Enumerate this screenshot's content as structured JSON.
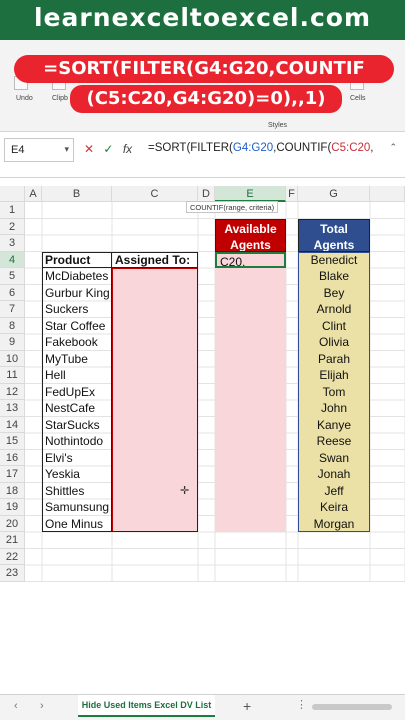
{
  "banner": {
    "text": "learnexceltoexcel.com"
  },
  "ribbon": {
    "undo_label": "Undo",
    "clipboard_label": "Clipb",
    "cells_label": "Cells",
    "styles_label": "Styles"
  },
  "overlay": {
    "line1": "=SORT(FILTER(G4:G20,COUNTIF",
    "line2": "(C5:C20,G4:G20)=0),,1)"
  },
  "formula_bar": {
    "name_box": "E4",
    "formula_prefix": "=SORT(FILTER(",
    "formula_ref1": "G4:G20",
    "formula_mid": ",COUNTIF(",
    "formula_ref2": "C5:C20",
    "formula_suffix": ","
  },
  "tooltip": "COUNTIF(range, criteria)",
  "columns": [
    "A",
    "B",
    "C",
    "D",
    "E",
    "F",
    "G"
  ],
  "rows": [
    "1",
    "2",
    "3",
    "4",
    "5",
    "6",
    "7",
    "8",
    "9",
    "10",
    "11",
    "12",
    "13",
    "14",
    "15",
    "16",
    "17",
    "18",
    "19",
    "20",
    "21",
    "22",
    "23"
  ],
  "table": {
    "header_product": "Product",
    "header_assigned": "Assigned To:",
    "products": [
      "McDiabetes",
      "Gurbur King",
      "Suckers",
      "Star Coffee",
      "Fakebook",
      "MyTube",
      "Hell",
      "FedUpEx",
      "NestCafe",
      "StarSucks",
      "Nothintodo",
      "Elvi's",
      "Yeskia",
      "Shittles",
      "Samunsung",
      "One Minus"
    ]
  },
  "available": {
    "header": "Available Agents",
    "edit_value": "C20,"
  },
  "total": {
    "header": "Total Agents",
    "agents": [
      "Benedict",
      "Blake",
      "Bey",
      "Arnold",
      "Clint",
      "Olivia",
      "Parah",
      "Elijah",
      "Tom",
      "John",
      "Kanye",
      "Reese",
      "Swan",
      "Jonah",
      "Jeff",
      "Keira",
      "Morgan"
    ]
  },
  "sheet_tab": "Hide Used Items Excel DV List",
  "colors": {
    "banner_green": "#1d6f3f",
    "overlay_red": "#e9242f",
    "available_header": "#c00000",
    "total_header": "#2e4e8f",
    "pink_fill": "#f9d6da",
    "yellow_fill": "#ebe1a6"
  }
}
